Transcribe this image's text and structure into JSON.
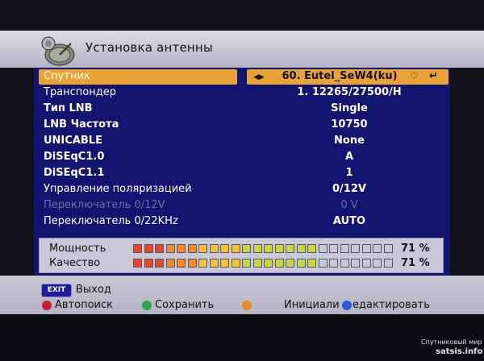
{
  "header": {
    "title": "Установка антенны"
  },
  "rows": [
    {
      "label": "Спутник",
      "value": "60. Eutel_SeW4(ku)"
    },
    {
      "label": "Транспондер",
      "value": "1. 12265/27500/H"
    },
    {
      "label": "Тип LNB",
      "value": "Single"
    },
    {
      "label": "LNB Частота",
      "value": "10750"
    },
    {
      "label": "UNICABLE",
      "value": "None"
    },
    {
      "label": "DiSEqC1.0",
      "value": "A"
    },
    {
      "label": "DiSEqC1.1",
      "value": "1"
    },
    {
      "label": "Управление поляризацией",
      "value": "0/12V"
    },
    {
      "label": "Переключатель 0/12V",
      "value": "0 V",
      "disabled": true
    },
    {
      "label": "Переключатель 0/22KHz",
      "value": "AUTO"
    }
  ],
  "signal": {
    "power": {
      "label": "Мощность",
      "percent": "71 %",
      "level": 0.71
    },
    "quality": {
      "label": "Качество",
      "percent": "71 %",
      "level": 0.71
    }
  },
  "footer": {
    "exit_badge": "EXIT",
    "exit_label": "Выход",
    "red_label": "Автопоиск",
    "green_label": "Сохранить",
    "blue_label_left": "Инициали",
    "blue_label_right": "едактировать",
    "colors": {
      "red": "#c81e2e",
      "green": "#2ea84a",
      "orange": "#e88c2a",
      "blue": "#2a5ad8"
    }
  },
  "watermark": {
    "line1": "Спутниковый мир",
    "line2": "satsis.info"
  },
  "icons": {
    "header": "satellite-dish-icon",
    "arrows": "left-right-arrows-icon",
    "heart": "heart-icon",
    "enter": "enter-icon"
  }
}
